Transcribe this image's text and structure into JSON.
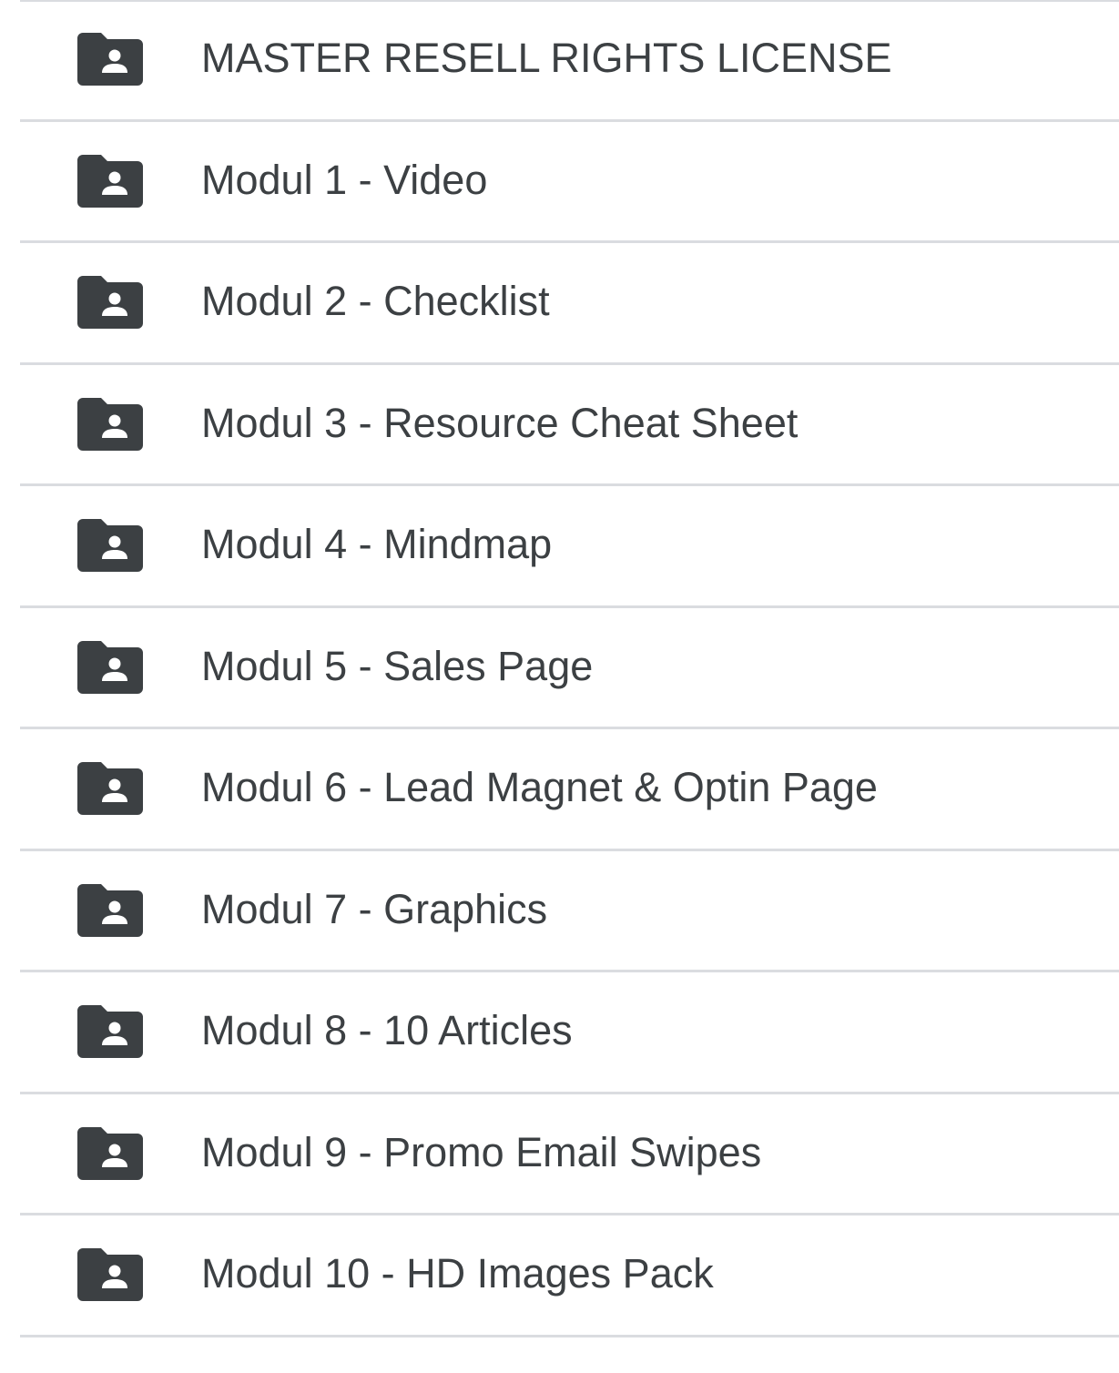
{
  "file_list": {
    "items": [
      {
        "name": "MASTER RESELL RIGHTS LICENSE",
        "icon": "shared-folder-icon"
      },
      {
        "name": "Modul 1 - Video",
        "icon": "shared-folder-icon"
      },
      {
        "name": "Modul 2 - Checklist",
        "icon": "shared-folder-icon"
      },
      {
        "name": "Modul 3 - Resource Cheat Sheet",
        "icon": "shared-folder-icon"
      },
      {
        "name": "Modul 4 - Mindmap",
        "icon": "shared-folder-icon"
      },
      {
        "name": "Modul 5 - Sales Page",
        "icon": "shared-folder-icon"
      },
      {
        "name": "Modul 6 - Lead Magnet & Optin Page",
        "icon": "shared-folder-icon"
      },
      {
        "name": "Modul 7 - Graphics",
        "icon": "shared-folder-icon"
      },
      {
        "name": "Modul 8 - 10 Articles",
        "icon": "shared-folder-icon"
      },
      {
        "name": "Modul 9 - Promo Email Swipes",
        "icon": "shared-folder-icon"
      },
      {
        "name": "Modul 10 - HD Images Pack",
        "icon": "shared-folder-icon"
      }
    ]
  },
  "colors": {
    "icon": "#3c4043",
    "text": "#3c4043",
    "divider": "#dadce0",
    "background": "#ffffff"
  }
}
